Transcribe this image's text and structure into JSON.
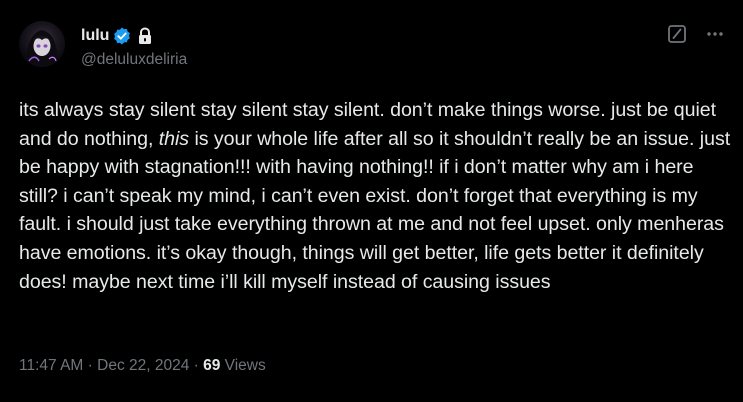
{
  "author": {
    "display_name": "lulu",
    "handle": "@deluluxdeliria",
    "verified": true,
    "protected": true
  },
  "tweet": {
    "text_before_italic": "its always stay silent stay silent stay silent. don’t make things worse. just be quiet and do nothing, ",
    "italic_word": "this",
    "text_after_italic": " is your whole life after all so it shouldn’t really be an issue. just be happy with stagnation!!! with having nothing!! if i don’t matter why am i here still? i can’t speak my mind, i can’t even exist. don’t forget that everything is my fault. i should just take everything thrown at me and not feel upset. only menheras have emotions. it’s okay though, things will get better, life gets better it definitely does! maybe next time i’ll kill myself instead of causing issues"
  },
  "meta": {
    "time": "11:47 AM",
    "separator": " · ",
    "date": "Dec 22, 2024",
    "views_count": "69",
    "views_label": " Views"
  },
  "icons": {
    "verified": "verified-badge-icon",
    "lock": "lock-icon",
    "grok": "grok-icon",
    "more": "more-icon"
  },
  "colors": {
    "background": "#000000",
    "primary_text": "#e7e9ea",
    "secondary_text": "#71767b",
    "verified_blue": "#1d9bf0"
  }
}
